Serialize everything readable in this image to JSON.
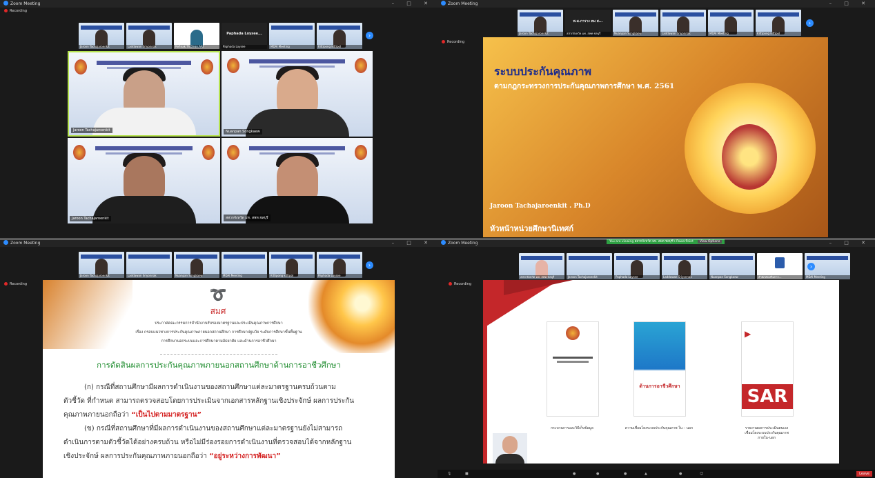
{
  "window": {
    "title": "Zoom Meeting",
    "recording": "Recording"
  },
  "q1": {
    "thumbs": [
      {
        "name": "Jaroon Tachajaroenkit"
      },
      {
        "name": "Laddawan Sriyonnak"
      },
      {
        "name": "Refinak.Th.Dean.AAT"
      },
      {
        "name": "Paphada Loysee"
      },
      {
        "name": "MDAI Meeting"
      },
      {
        "name": "Kittipong kittipol"
      }
    ],
    "dark_name": "Paphada Loysee...",
    "tiles": [
      {
        "name": "Jaroon Tachajaroenkit"
      },
      {
        "name": "Nuanpan Songkaew"
      },
      {
        "name": "Jaroon Tachajaroenkit"
      },
      {
        "name": "สสวกจังหวัด มท. สพท.ชลบุรี"
      }
    ]
  },
  "q2": {
    "thumbs": [
      "Jaroon Tachajaroenkit",
      "พ.ม.การาง คม ส...",
      "สสวกจังหวัด มท. สพท.ชลบุรี",
      "Nuanpan Songkaew",
      "Laddawan Sriyonnak",
      "MDAI Meeting",
      "Kittipong kittipol"
    ],
    "slide": {
      "title": "ระบบประกันคุณภาพ",
      "subtitle": "ตามกฎกระทรวงการประกันคุณภาพการศึกษา พ.ศ. 2561",
      "presenter": "Jaroon  Tachajaroenkit . Ph.D",
      "role": "หัวหน้าหน่วยศึกษานิเทศก์"
    }
  },
  "q3": {
    "thumbs": [
      "Jaroon Tachajaroenkit",
      "Laddawan Sriyonnak",
      "Nuanpan Songkaew",
      "MDAI Meeting",
      "Kittipong kittipol",
      "Paphada Loysee"
    ],
    "slide": {
      "logo": "สมศ",
      "ann1": "ประกาศคณะกรรมการสำนักงานรับรองมาตรฐานและประเมินคุณภาพการศึกษา",
      "ann2": "เรื่อง กรอบแนวทางการประกันคุณภาพภายนอกสถานศึกษา การศึกษาปฐมวัย ระดับการศึกษาขั้นพื้นฐาน",
      "ann3": "การศึกษานอกระบบและการศึกษาตามอัธยาศัย และด้านการอาชีวศึกษา",
      "heading": "การตัดสินผลการประกันคุณภาพภายนอกสถานศึกษาด้านการอาชีวศึกษา",
      "l1": "(ก) กรณีที่สถานศึกษามีผลการดำเนินงานของสถานศึกษาแต่ละมาตรฐานครบถ้วนตาม",
      "l2": "ตัวชี้วัด ที่กำหนด สามารถตรวจสอบโดยการประเมินจากเอกสารหลักฐานเชิงประจักษ์ ผลการประกัน",
      "l3a": "คุณภาพภายนอกถือว่า ",
      "l3b": "“เป็นไปตามมาตรฐาน”",
      "l4": "(ข) กรณีที่สถานศึกษาที่มีผลการดำเนินงานของสถานศึกษาแต่ละมาตรฐานยังไม่สามารถ",
      "l5": "ดำเนินการตามตัวชี้วัดได้อย่างครบถ้วน หรือไม่มีร่องรอยการดำเนินงานที่ตรวจสอบได้จากหลักฐาน",
      "l6a": "เชิงประจักษ์ ผลการประกันคุณภาพภายนอกถือว่า ",
      "l6b": "“อยู่ระหว่างการพัฒนา”"
    }
  },
  "q4": {
    "sharebar": "You are viewing สสวกจังหวัด มท. สพท.ชลบุรี's PowerPoint",
    "view_options": "View Options",
    "thumbs": [
      "สสวกจังหวัด มท. สพท.ชลบุรี",
      "Jaroon Tachajaroenkit",
      "Paphada Loysee",
      "Laddawan Sriyonnak",
      "Nuanpan Songkaew",
      "สำนักส่งเสริมการ...",
      "MDAI Meeting"
    ],
    "slide": {
      "cap1": "กระบวนการและวิธีเก็บข้อมูล",
      "cap2": "ความเชื่อมโยงระบบประกันคุณภาพ ใน – นอก",
      "cap3a": "รายงานผลการประเมินตนเอง",
      "cap3b": "เชื่อมโยงระบบประกันคุณภาพ",
      "cap3c": "ภายใน-นอก",
      "doc2": "ด้านการอาชีวศึกษา",
      "doc3": "SAR"
    },
    "leave": "Leave"
  }
}
